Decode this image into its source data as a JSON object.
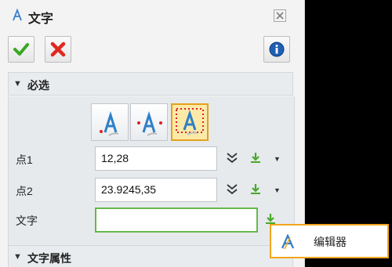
{
  "dialog": {
    "title": "文字",
    "close_icon": "close-icon"
  },
  "toolbar": {
    "ok_icon": "checkmark-icon",
    "cancel_icon": "cancel-x-icon",
    "info_icon": "info-icon"
  },
  "sections": {
    "required_label": "必选",
    "text_properties_label": "文字属性"
  },
  "modes": [
    "text-point-mode-icon",
    "text-two-point-mode-icon",
    "text-box-mode-icon"
  ],
  "fields": {
    "point1_label": "点1",
    "point1_value": "12,28",
    "point2_label": "点2",
    "point2_value": "23.9245,35",
    "text_label": "文字",
    "text_value": ""
  },
  "popup": {
    "editor_label": "编辑器",
    "editor_icon": "text-editor-icon"
  },
  "colors": {
    "accent_orange": "#f2a51c",
    "ok_green": "#38a820",
    "cancel_red": "#e0281f",
    "focus_green": "#67b84a",
    "info_blue": "#1f5fb4"
  }
}
